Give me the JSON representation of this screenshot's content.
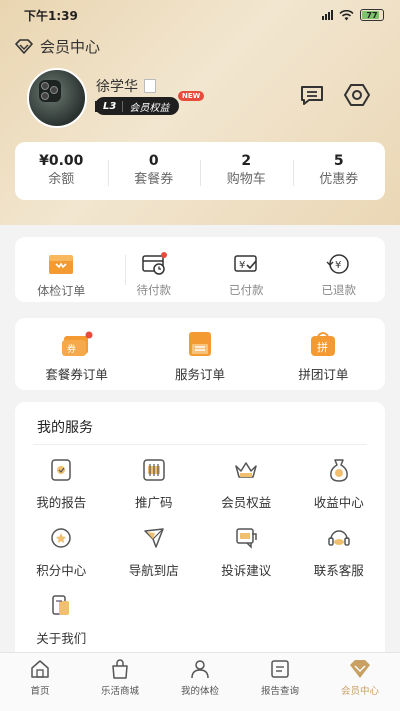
{
  "status_bar": {
    "time": "下午1:39",
    "battery": "77"
  },
  "title_bar": {
    "title": "会员中心"
  },
  "profile": {
    "name": "徐学华",
    "level": "L3",
    "member_label": "会员权益",
    "new_badge": "NEW"
  },
  "stats": [
    {
      "value": "¥0.00",
      "label": "余额"
    },
    {
      "value": "0",
      "label": "套餐券"
    },
    {
      "value": "2",
      "label": "购物车"
    },
    {
      "value": "5",
      "label": "优惠券"
    }
  ],
  "orders": [
    {
      "label": "体检订单",
      "icon": "exam-order-icon"
    },
    {
      "label": "待付款",
      "icon": "pending-payment-icon"
    },
    {
      "label": "已付款",
      "icon": "paid-icon"
    },
    {
      "label": "已退款",
      "icon": "refunded-icon"
    }
  ],
  "orders2": [
    {
      "label": "套餐券订单",
      "icon": "package-voucher-order-icon"
    },
    {
      "label": "服务订单",
      "icon": "service-order-icon"
    },
    {
      "label": "拼团订单",
      "icon": "group-buy-order-icon"
    }
  ],
  "services": {
    "title": "我的服务",
    "items": [
      {
        "label": "我的报告",
        "icon": "report-icon"
      },
      {
        "label": "推广码",
        "icon": "promo-code-icon"
      },
      {
        "label": "会员权益",
        "icon": "crown-icon"
      },
      {
        "label": "收益中心",
        "icon": "money-bag-icon"
      },
      {
        "label": "积分中心",
        "icon": "points-icon"
      },
      {
        "label": "导航到店",
        "icon": "navigation-icon"
      },
      {
        "label": "投诉建议",
        "icon": "feedback-icon"
      },
      {
        "label": "联系客服",
        "icon": "customer-service-icon"
      },
      {
        "label": "关于我们",
        "icon": "about-icon"
      }
    ]
  },
  "tab_bar": [
    {
      "label": "首页",
      "icon": "home-icon"
    },
    {
      "label": "乐活商城",
      "icon": "shop-bag-icon"
    },
    {
      "label": "我的体检",
      "icon": "person-icon"
    },
    {
      "label": "报告查询",
      "icon": "report-query-icon"
    },
    {
      "label": "会员中心",
      "icon": "member-diamond-icon",
      "active": true
    }
  ],
  "colors": {
    "accent": "#c8a064",
    "orange": "#f39a32",
    "badge_red": "#e84b3c",
    "header_gold": "#e9d5b0"
  }
}
